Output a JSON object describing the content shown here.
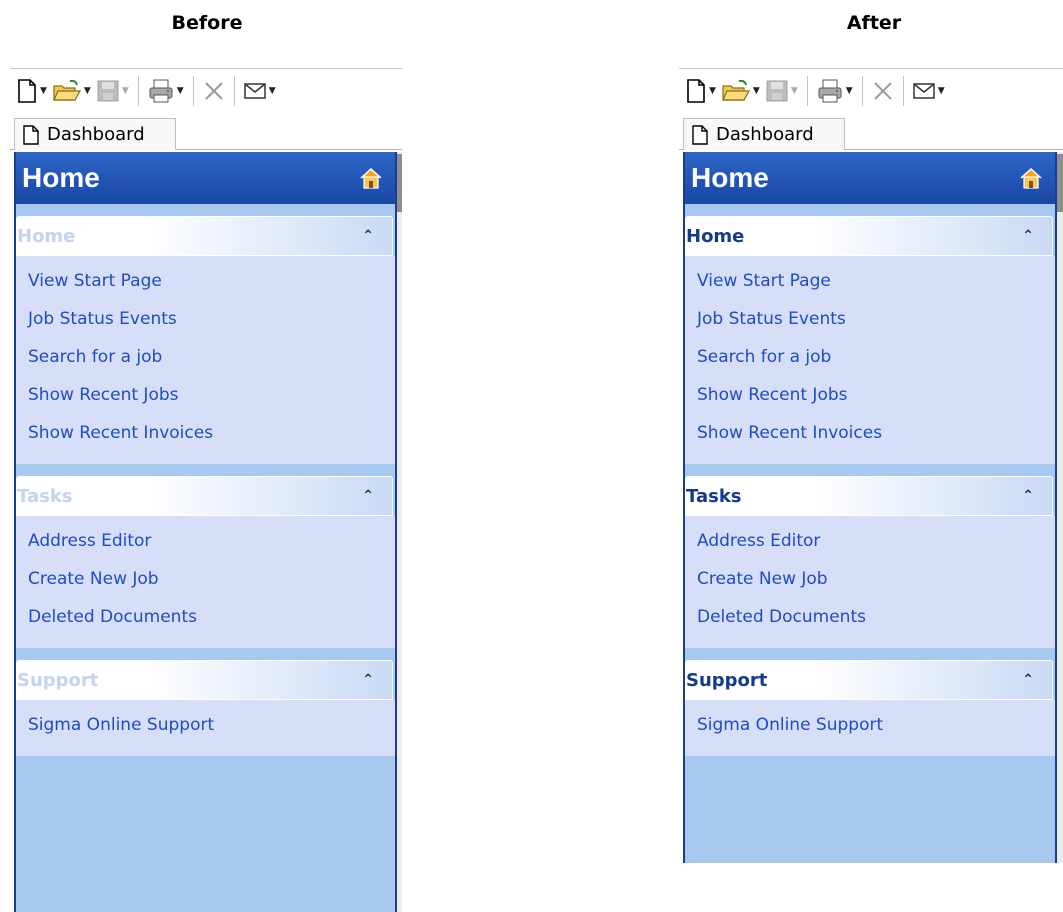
{
  "headings": {
    "before": "Before",
    "after": "After"
  },
  "tab": {
    "label": "Dashboard"
  },
  "nav": {
    "title": "Home",
    "groups": [
      {
        "title": "Home",
        "items": [
          "View Start Page",
          "Job Status Events",
          "Search for a job",
          "Show Recent Jobs",
          "Show Recent Invoices"
        ]
      },
      {
        "title": "Tasks",
        "items": [
          "Address Editor",
          "Create New Job",
          "Deleted Documents"
        ]
      },
      {
        "title": "Support",
        "items": [
          "Sigma Online Support"
        ]
      }
    ]
  },
  "toolbar": {
    "icons": [
      "new-document-icon",
      "open-folder-icon",
      "save-icon",
      "print-icon",
      "delete-icon",
      "email-icon"
    ]
  },
  "colors": {
    "nav_header": "#1a47a6",
    "group_body": "#d6dff7",
    "nav_bg": "#a7c8ef",
    "link": "#1f4cc6",
    "group_title_after": "#133a8c",
    "group_title_before": "#c5d3ee"
  }
}
